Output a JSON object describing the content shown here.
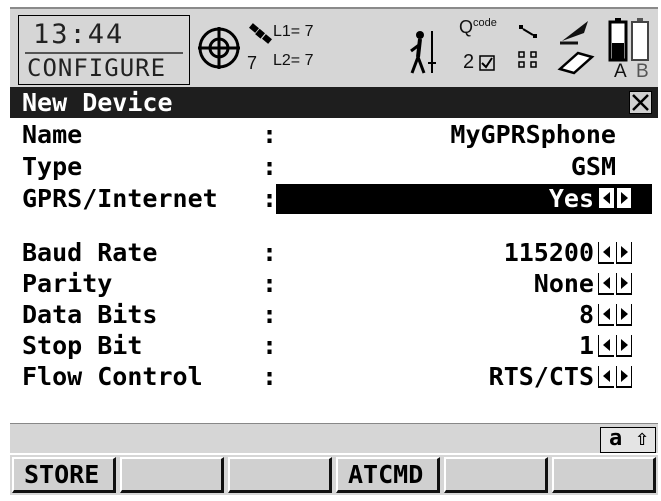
{
  "status": {
    "time": "13:44",
    "mode": "CONFIGURE",
    "satellites_tracked": "7",
    "l1_label": "L1= 7",
    "l2_label": "L2= 7",
    "code_label": "Q",
    "code_sup": "code",
    "fix_count": "2",
    "battery_a": "A",
    "battery_b": "B"
  },
  "dialog": {
    "title": "New Device"
  },
  "fields": [
    {
      "label": "Name",
      "value": "MyGPRSphone",
      "has_arrows": false,
      "selected": false
    },
    {
      "label": "Type",
      "value": "GSM",
      "has_arrows": false,
      "selected": false
    },
    {
      "label": "GPRS/Internet",
      "value": "Yes",
      "has_arrows": true,
      "selected": true
    },
    {
      "label": "Baud Rate",
      "value": "115200",
      "has_arrows": true,
      "selected": false
    },
    {
      "label": "Parity",
      "value": "None",
      "has_arrows": true,
      "selected": false
    },
    {
      "label": "Data Bits",
      "value": "8",
      "has_arrows": true,
      "selected": false
    },
    {
      "label": "Stop Bit",
      "value": "1",
      "has_arrows": true,
      "selected": false
    },
    {
      "label": "Flow Control",
      "value": "RTS/CTS",
      "has_arrows": true,
      "selected": false
    }
  ],
  "colon": ":",
  "keyboard_indicator": "a ⇧",
  "softkeys": [
    "STORE",
    "",
    "",
    "ATCMD",
    "",
    ""
  ],
  "colors": {
    "background": "#ffffff",
    "bar_gray": "#d6d6d6",
    "title_bg": "#1e1e1e",
    "selection_bg": "#000000"
  }
}
